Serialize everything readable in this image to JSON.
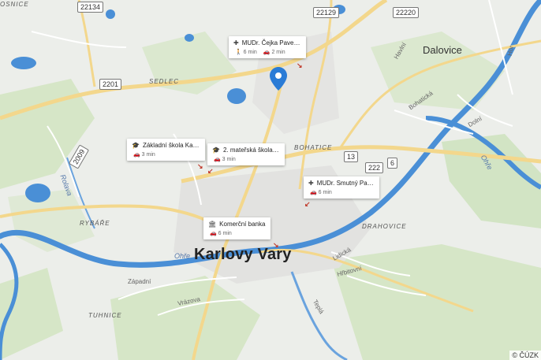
{
  "map": {
    "copyright": "© ČÚZK",
    "places": {
      "city": "Karlovy Vary",
      "dalovice": "Dalovice",
      "sedlec": "SEDLEC",
      "bohatice": "BOHATICE",
      "rybare": "RYBÁŘE",
      "drahovice": "DRAHOVICE",
      "tuhnice": "TUHNICE",
      "osnice": "OSNICE"
    },
    "streets": {
      "zapadni": "Západní",
      "vrazova": "Vrázova",
      "lidicka": "Lidická",
      "hrbitovni": "Hřbitovní",
      "bohatecka": "Bohatická",
      "dolni": "Dolní",
      "havlní": "Havlní",
      "hor": "Hor",
      "tepla": "Teplá",
      "ohre1": "Ohře",
      "ohre2": "Ohře",
      "rolava": "Rolava"
    },
    "road_numbers": {
      "r22134": "22134",
      "r22129": "22129",
      "r22220": "22220",
      "r2201": "2201",
      "r2009": "2009",
      "r13": "13",
      "r222": "222",
      "r6": "6"
    },
    "pois": [
      {
        "name": "MUDr. Čejka Pave…",
        "icon": "medical-icon",
        "walk": "6 min",
        "drive": "2 min"
      },
      {
        "name": "Základní škola Ka…",
        "icon": "school-icon",
        "drive": "3 min"
      },
      {
        "name": "2. mateřská škola…",
        "icon": "school-icon",
        "drive": "3 min"
      },
      {
        "name": "MUDr. Smutný Pa…",
        "icon": "medical-icon",
        "drive": "6 min"
      },
      {
        "name": "Komerční banka",
        "icon": "bank-icon",
        "drive": "6 min"
      }
    ],
    "colors": {
      "water": "#4a8fd6",
      "major_road": "#f5d98a",
      "green": "#cfe3bd",
      "marker": "#2a7bd6"
    }
  }
}
